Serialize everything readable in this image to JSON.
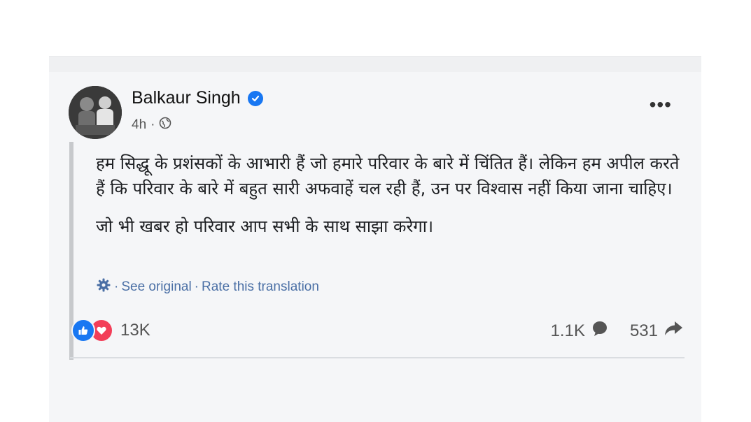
{
  "post": {
    "author": "Balkaur Singh",
    "time": "4h",
    "separator": "·",
    "more_label": "•••",
    "paragraphs": [
      "हम सिद्धू के प्रशंसकों के आभारी हैं जो हमारे परिवार के बारे में चिंतित हैं। लेकिन हम अपील करते हैं कि परिवार के बारे में बहुत सारी अफवाहें चल रही हैं, उन पर विश्वास नहीं किया जाना चाहिए।",
      "जो भी खबर हो परिवार आप सभी के साथ साझा करेगा।"
    ],
    "translation": {
      "see_original": "See original",
      "dot": "·",
      "rate": "Rate this translation"
    },
    "reactions_count": "13K",
    "comments_count": "1.1K",
    "shares_count": "531"
  },
  "colors": {
    "accent": "#1877f2",
    "love": "#f33e58",
    "link": "#4a6fa5"
  },
  "icons": [
    "verified-badge-icon",
    "globe-icon",
    "more-icon",
    "settings-gear-icon",
    "like-icon",
    "love-icon",
    "comment-icon",
    "share-icon"
  ]
}
